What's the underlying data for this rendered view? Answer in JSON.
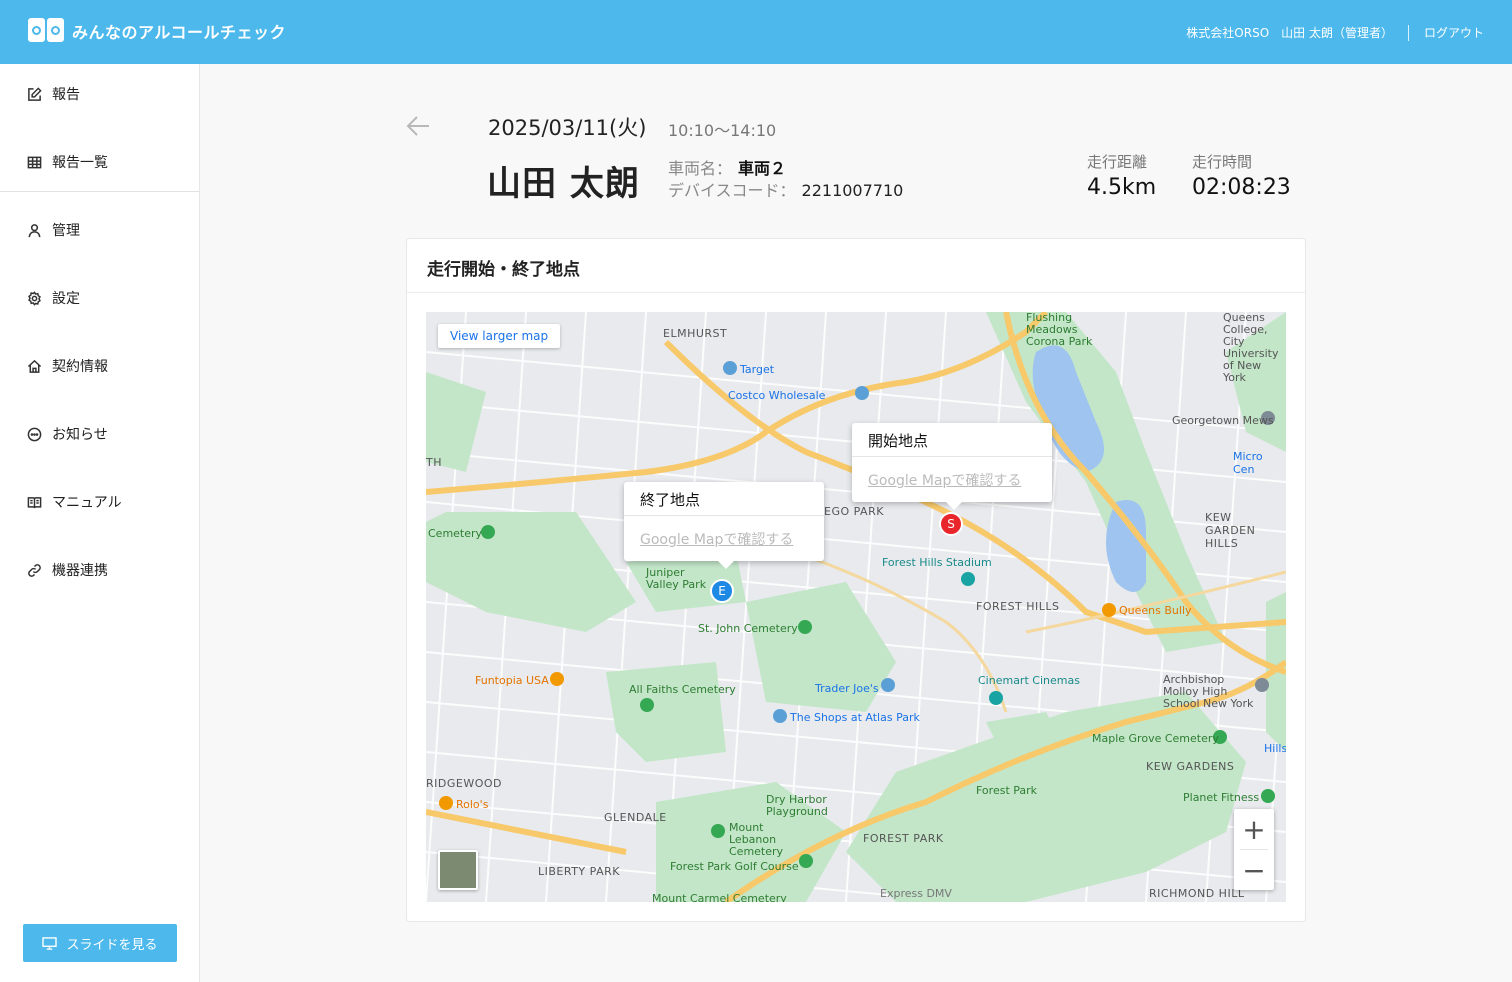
{
  "header": {
    "app_title": "みんなのアルコールチェック",
    "company": "株式会社ORSO",
    "user": "山田 太朗（管理者）",
    "logout": "ログアウト"
  },
  "sidebar": {
    "items": [
      {
        "label": "報告",
        "icon": "edit-icon"
      },
      {
        "label": "報告一覧",
        "icon": "table-icon"
      },
      {
        "label": "管理",
        "icon": "user-icon"
      },
      {
        "label": "設定",
        "icon": "gear-icon"
      },
      {
        "label": "契約情報",
        "icon": "home-icon"
      },
      {
        "label": "お知らせ",
        "icon": "chat-icon"
      },
      {
        "label": "マニュアル",
        "icon": "book-icon"
      },
      {
        "label": "機器連携",
        "icon": "link-icon"
      }
    ],
    "slide_button": "スライドを見る"
  },
  "record": {
    "date": "2025/03/11(火)",
    "time_range": "10:10〜14:10",
    "driver_name": "山田 太朗",
    "vehicle_label": "車両名：",
    "vehicle_value": "車両２",
    "device_label": "デバイスコード：",
    "device_value": "2211007710",
    "distance_label": "走行距離",
    "distance_value": "4.5km",
    "duration_label": "走行時間",
    "duration_value": "02:08:23"
  },
  "map_card": {
    "title": "走行開始・終了地点",
    "view_larger": "View larger map",
    "start_popup": {
      "title": "開始地点",
      "link": "Google Mapで確認する"
    },
    "end_popup": {
      "title": "終了地点",
      "link": "Google Mapで確認する"
    },
    "start_marker": "S",
    "end_marker": "E",
    "zoom_in": "+",
    "zoom_out": "−",
    "labels": {
      "elmhurst": "ELMHURST",
      "rego_park": "EGO PARK",
      "forest_hills": "FOREST HILLS",
      "kew_gardens_hills": "KEW GARDEN HILLS",
      "ridgewood": "RIDGEWOOD",
      "glendale": "GLENDALE",
      "liberty_park": "LIBERTY PARK",
      "forest_park": "FOREST PARK",
      "kew_gardens": "KEW GARDENS",
      "richmond_hill": "RICHMOND HILL",
      "target": "Target",
      "costco": "Costco Wholesale",
      "flushing": "Flushing Meadows Corona Park",
      "georgetown": "Georgetown Mews",
      "micro_center": "Micro Cen",
      "forest_hills_stadium": "Forest Hills Stadium",
      "queens_bully": "Queens Bully",
      "juniper": "Juniper Valley Park",
      "st_john": "St. John Cemetery",
      "funtopia": "Funtopia USA",
      "all_faiths": "All Faiths Cemetery",
      "trader_joes": "Trader Joe's",
      "shops_atlas": "The Shops at Atlas Park",
      "cinemart": "Cinemart Cinemas",
      "archbishop": "Archbishop Molloy High School New York",
      "maple_grove": "Maple Grove Cemetery",
      "forest_park_poi": "Forest Park",
      "planet_fitness": "Planet Fitness",
      "dry_harbor": "Dry Harbor Playground",
      "mount_lebanon": "Mount Lebanon Cemetery",
      "golf": "Forest Park Golf Course",
      "rolos": "Rolo's",
      "cemetery": "Cemetery",
      "express_dmv": "Express DMV",
      "queens_univ": "Queens College, City University of New York",
      "hillside": "Hillside",
      "mount_carmel": "Mount Carmel Cemetery",
      "th": "TH"
    }
  },
  "colors": {
    "header": "#4cb8ec",
    "start_marker": "#e8262c",
    "end_marker": "#1e88e5",
    "park": "#c3e6c9",
    "highway": "#f7c96a"
  }
}
